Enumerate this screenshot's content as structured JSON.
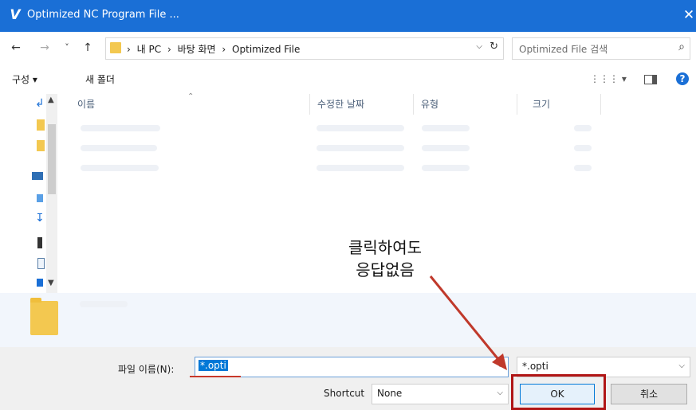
{
  "window": {
    "logo_letter": "V",
    "title": "Optimized NC Program File ...",
    "close_glyph": "✕"
  },
  "nav": {
    "back_glyph": "←",
    "forward_glyph": "→",
    "recent_glyph": "˅",
    "up_glyph": "↑",
    "breadcrumb": [
      "›",
      "내 PC",
      "›",
      "바탕 화면",
      "›",
      "Optimized File"
    ],
    "refresh_glyph": "↻",
    "search_placeholder": "Optimized File 검색",
    "search_icon": "⌕"
  },
  "toolbar": {
    "organize": "구성 ▾",
    "new_folder": "새 폴더",
    "view_glyph": "⋮⋮⋮ ▾",
    "help_glyph": "?"
  },
  "columns": {
    "name": "이름",
    "date": "수정한 날짜",
    "type": "유형",
    "size": "크기"
  },
  "bottom": {
    "filename_label": "파일 이름(N):",
    "filename_value": "*.opti",
    "filter_value": "*.opti",
    "shortcut_label": "Shortcut",
    "shortcut_value": "None",
    "ok_label": "OK",
    "cancel_label": "취소"
  },
  "annotation": {
    "line1": "클릭하여도",
    "line2": "응답없음"
  },
  "colors": {
    "titlebar": "#1a6fd6",
    "highlight": "#b01515",
    "arrow": "#c0392b"
  }
}
